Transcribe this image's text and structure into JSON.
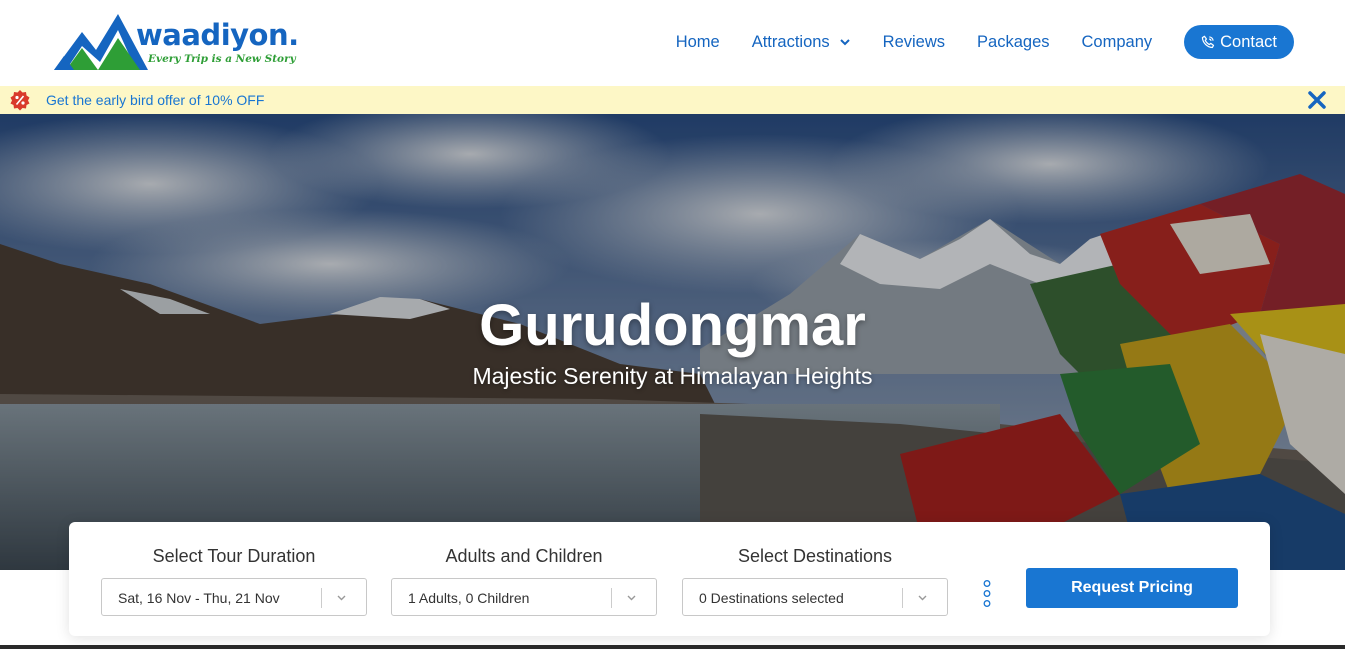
{
  "brand": {
    "name": "waadiyon.",
    "tagline": "Every Trip is a New Story",
    "primary_color": "#1565c0",
    "accent_color": "#2e9e36"
  },
  "nav": {
    "items": [
      {
        "label": "Home"
      },
      {
        "label": "Attractions",
        "has_dropdown": true
      },
      {
        "label": "Reviews"
      },
      {
        "label": "Packages"
      },
      {
        "label": "Company"
      }
    ],
    "contact_label": "Contact",
    "contact_icon": "phone-icon"
  },
  "offer": {
    "text": "Get the early bird offer of 10% OFF",
    "icon": "discount-badge-icon",
    "close_icon": "close-icon",
    "background": "#fdf7c6"
  },
  "hero": {
    "title": "Gurudongmar",
    "subtitle": "Majestic Serenity at Himalayan Heights"
  },
  "booking": {
    "duration": {
      "label": "Select Tour Duration",
      "value": "Sat, 16 Nov - Thu, 21 Nov"
    },
    "guests": {
      "label": "Adults and Children",
      "value": "1 Adults, 0 Children"
    },
    "destinations": {
      "label": "Select Destinations",
      "value": "0 Destinations selected"
    },
    "more_icon": "more-options-icon",
    "request_label": "Request Pricing",
    "button_color": "#1976d2"
  }
}
